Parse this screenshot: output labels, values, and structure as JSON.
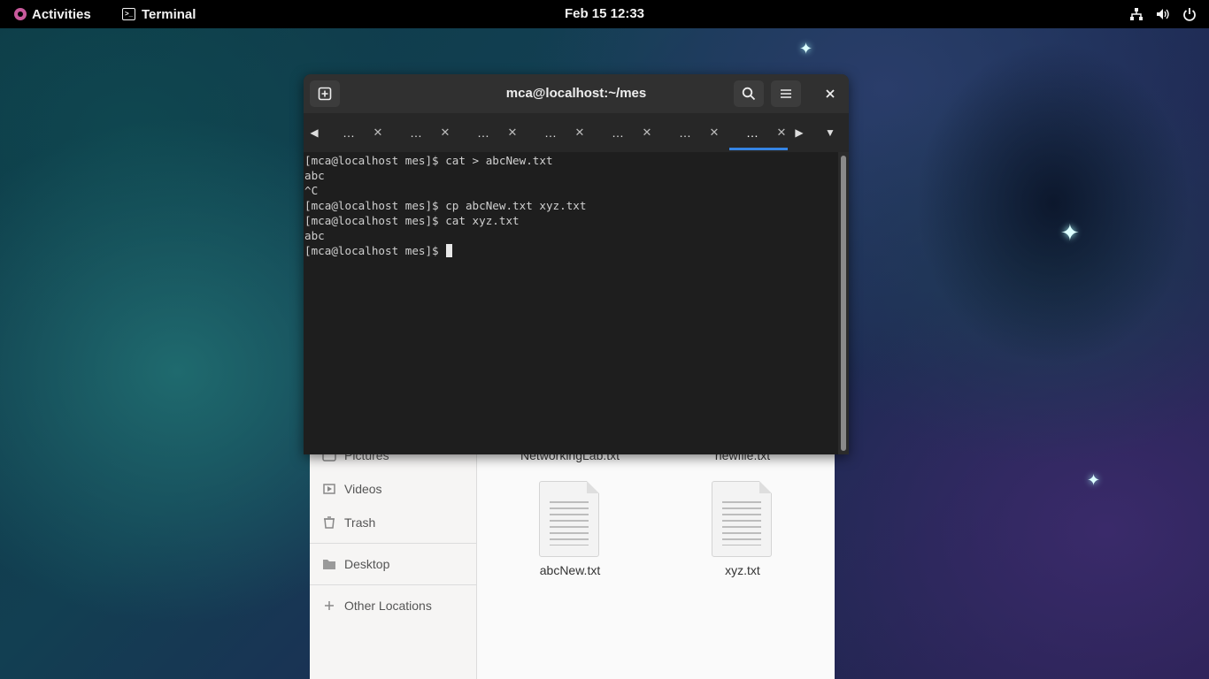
{
  "topbar": {
    "activities_label": "Activities",
    "app_label": "Terminal",
    "clock": "Feb 15  12:33",
    "tray_icons": [
      "network-icon",
      "volume-icon",
      "power-icon"
    ]
  },
  "terminal": {
    "title": "mca@localhost:~/mes",
    "tabs": [
      {
        "label": "…",
        "active": false
      },
      {
        "label": "…",
        "active": false
      },
      {
        "label": "…",
        "active": false
      },
      {
        "label": "…",
        "active": false
      },
      {
        "label": "…",
        "active": false
      },
      {
        "label": "…",
        "active": false
      },
      {
        "label": "…",
        "active": true
      }
    ],
    "close_glyph": "✕",
    "lines": [
      "[mca@localhost mes]$ cat > abcNew.txt",
      "abc",
      "^C",
      "[mca@localhost mes]$ cp abcNew.txt xyz.txt",
      "[mca@localhost mes]$ cat xyz.txt",
      "abc"
    ],
    "prompt": "[mca@localhost mes]$ "
  },
  "files": {
    "sidebar": {
      "pictures": "Pictures",
      "videos": "Videos",
      "trash": "Trash",
      "desktop": "Desktop",
      "other_locations": "Other Locations"
    },
    "partial_files": [
      "NetworkingLab.txt",
      "newfile.txt"
    ],
    "files": [
      "abcNew.txt",
      "xyz.txt"
    ]
  },
  "colors": {
    "accent": "#3584e4",
    "terminal_bg": "#1e1e1e",
    "topbar_bg": "#000000"
  }
}
